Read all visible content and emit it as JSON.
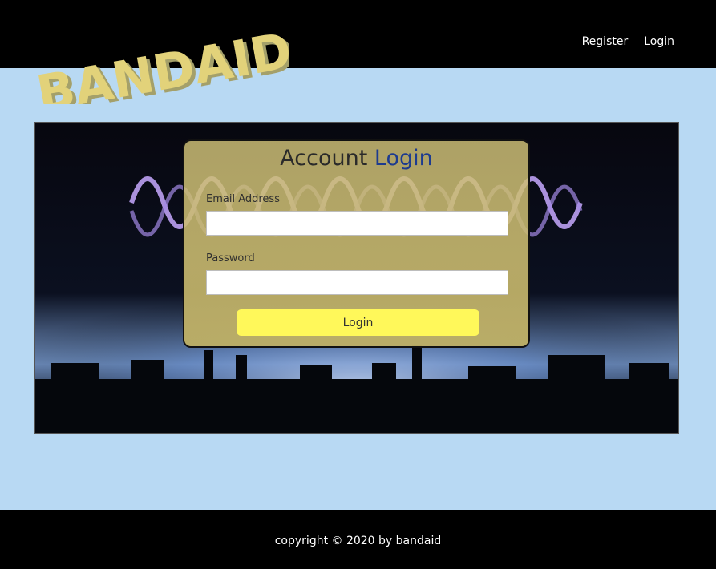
{
  "header": {
    "logo_text": "BANDAID",
    "nav": [
      {
        "label": "Register"
      },
      {
        "label": "Login"
      }
    ]
  },
  "login_card": {
    "title_part1": "Account",
    "title_part2": "Login",
    "email_label": "Email Address",
    "email_value": "",
    "password_label": "Password",
    "password_value": "",
    "submit_label": "Login"
  },
  "footer": {
    "copyright": "copyright © 2020 by bandaid"
  },
  "colors": {
    "header_bg": "#000000",
    "page_bg": "#b8d9f3",
    "logo_yellow": "#e2d27a",
    "title_accent": "#1d3b8f",
    "button_bg": "#fff85a"
  }
}
